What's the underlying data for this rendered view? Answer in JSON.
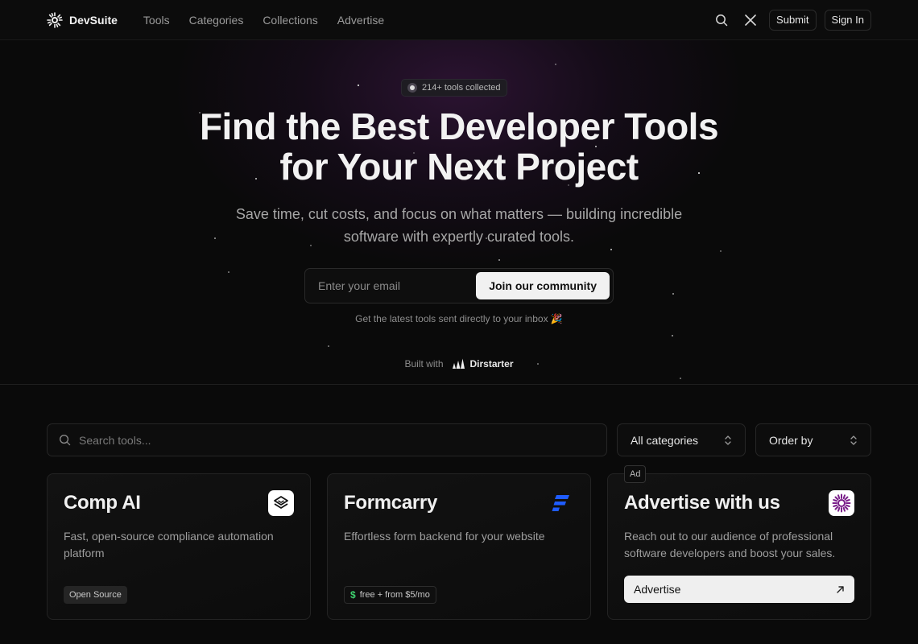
{
  "header": {
    "brand": "DevSuite",
    "nav": [
      "Tools",
      "Categories",
      "Collections",
      "Advertise"
    ],
    "submit_label": "Submit",
    "signin_label": "Sign In",
    "icons": [
      "search-icon",
      "x-logo-icon"
    ]
  },
  "hero": {
    "pill": "214+ tools collected",
    "title_line1": "Find the Best Developer Tools",
    "title_line2": "for Your Next Project",
    "subtitle": "Save time, cut costs, and focus on what matters — building incredible software with expertly curated tools.",
    "email_placeholder": "Enter your email",
    "join_label": "Join our community",
    "inbox_note": "Get the latest tools sent directly to your inbox 🎉",
    "built_with": "Built with",
    "built_brand": "Dirstarter"
  },
  "filters": {
    "search_placeholder": "Search tools...",
    "category": "All categories",
    "order": "Order by"
  },
  "cards": [
    {
      "title": "Comp AI",
      "description": "Fast, open-source compliance automation platform",
      "tag": "Open Source"
    },
    {
      "title": "Formcarry",
      "description": "Effortless form backend for your website",
      "tag": "free + from $5/mo"
    },
    {
      "badge": "Ad",
      "title": "Advertise with us",
      "description": "Reach out to our audience of professional software developers and boost your sales.",
      "cta": "Advertise"
    }
  ],
  "colors": {
    "background": "#0a0a0a",
    "accent_purple": "#7a1f8a",
    "formcarry_blue": "#1f5cff",
    "price_green": "#3ecf6e"
  }
}
